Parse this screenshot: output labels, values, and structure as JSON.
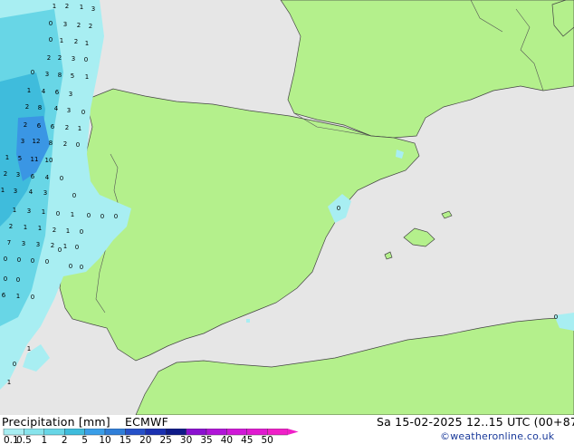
{
  "title": "Precipitation [mm]",
  "model": "ECMWF",
  "valid_time": "Sa 15-02-2025 12..15 UTC (00+87)",
  "credit": "©weatheronline.co.uk",
  "colorbar": {
    "labels": [
      "0.1",
      "0.5",
      "1",
      "2",
      "5",
      "10",
      "15",
      "20",
      "25",
      "30",
      "35",
      "40",
      "45",
      "50"
    ],
    "colors": [
      "#a8eef2",
      "#88e4ec",
      "#68d6e6",
      "#3fbcdc",
      "#3a9ee8",
      "#2f7ed8",
      "#2550c8",
      "#1a30b0",
      "#0e1a88",
      "#8a10d0",
      "#b014d8",
      "#d018d8",
      "#e01ad0",
      "#f020c8"
    ]
  },
  "colors": {
    "sea": "#e6e6e6",
    "land": "#b4f08c",
    "precip_light": "#a8eef2",
    "precip_mid": "#5cc6ea",
    "precip_heavy": "#3a96e4",
    "border": "#444444"
  },
  "grid_values": [
    {
      "v": "1"
    },
    {
      "v": "2"
    },
    {
      "v": "1"
    },
    {
      "v": "3"
    },
    {
      "v": "0"
    },
    {
      "v": "3"
    },
    {
      "v": "2"
    },
    {
      "v": "2"
    },
    {
      "v": "0"
    },
    {
      "v": "1"
    },
    {
      "v": "2"
    },
    {
      "v": "1"
    },
    {
      "v": "2"
    },
    {
      "v": "2"
    },
    {
      "v": "3"
    },
    {
      "v": "0"
    },
    {
      "v": "0"
    },
    {
      "v": "3"
    },
    {
      "v": "8"
    },
    {
      "v": "5"
    },
    {
      "v": "1"
    },
    {
      "v": "1"
    },
    {
      "v": "4"
    },
    {
      "v": "6"
    },
    {
      "v": "3"
    },
    {
      "v": "2"
    },
    {
      "v": "8"
    },
    {
      "v": "4"
    },
    {
      "v": "3"
    },
    {
      "v": "0"
    },
    {
      "v": "2"
    },
    {
      "v": "6"
    },
    {
      "v": "6"
    },
    {
      "v": "2"
    },
    {
      "v": "1"
    },
    {
      "v": "3"
    },
    {
      "v": "12"
    },
    {
      "v": "8"
    },
    {
      "v": "2"
    },
    {
      "v": "0"
    },
    {
      "v": "1"
    },
    {
      "v": "5"
    },
    {
      "v": "11"
    },
    {
      "v": "10"
    },
    {
      "v": "2"
    },
    {
      "v": "3"
    },
    {
      "v": "6"
    },
    {
      "v": "4"
    },
    {
      "v": "0"
    },
    {
      "v": "1"
    },
    {
      "v": "3"
    },
    {
      "v": "4"
    },
    {
      "v": "3"
    },
    {
      "v": "0"
    },
    {
      "v": "1"
    },
    {
      "v": "3"
    },
    {
      "v": "1"
    },
    {
      "v": "0"
    },
    {
      "v": "1"
    },
    {
      "v": "0"
    },
    {
      "v": "0"
    },
    {
      "v": "2"
    },
    {
      "v": "1"
    },
    {
      "v": "1"
    },
    {
      "v": "2"
    },
    {
      "v": "1"
    },
    {
      "v": "0"
    },
    {
      "v": "7"
    },
    {
      "v": "3"
    },
    {
      "v": "3"
    },
    {
      "v": "2"
    },
    {
      "v": "1"
    },
    {
      "v": "0"
    },
    {
      "v": "0"
    },
    {
      "v": "0"
    },
    {
      "v": "0"
    },
    {
      "v": "0"
    },
    {
      "v": "0"
    },
    {
      "v": "0"
    },
    {
      "v": "0"
    },
    {
      "v": "0"
    },
    {
      "v": "6"
    },
    {
      "v": "1"
    },
    {
      "v": "0"
    },
    {
      "v": "0"
    },
    {
      "v": "0"
    },
    {
      "v": "1"
    },
    {
      "v": "0"
    },
    {
      "v": "1"
    },
    {
      "v": "0"
    },
    {
      "v": "0"
    }
  ]
}
